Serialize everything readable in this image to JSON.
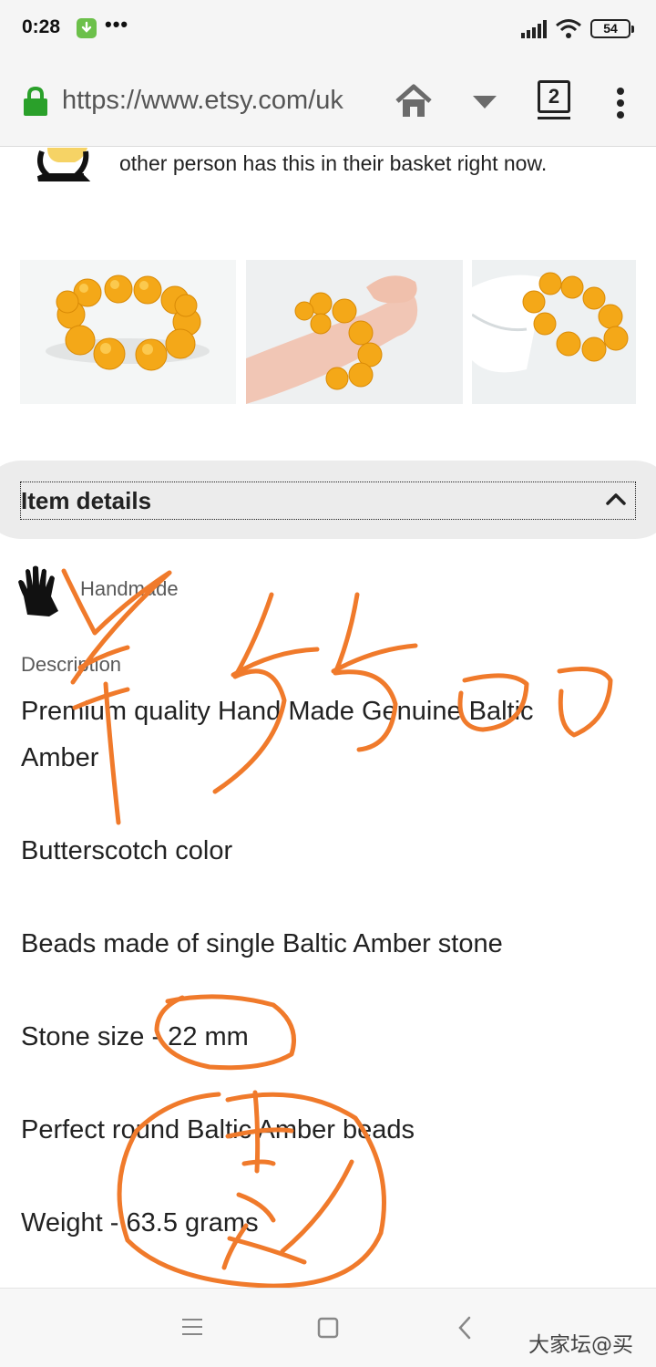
{
  "status_bar": {
    "time": "0:28",
    "dots": "•••",
    "battery": "54"
  },
  "browser": {
    "url": "https://www.etsy.com/uk",
    "tab_count": "2"
  },
  "listing": {
    "basket_notice": "other person has this in their basket right now.",
    "item_details_title": "Item details",
    "handmade_label": "Handmade",
    "description_label": "Description",
    "description_lines": [
      "Premium quality Hand Made Genuine Baltic",
      "Amber",
      "Butterscotch color",
      "Beads made of single Baltic Amber stone",
      "Stone size - 22 mm",
      "Perfect round Baltic Amber beads",
      "Weight - 63.5 grams"
    ]
  },
  "watermark": "大家坛@买",
  "colors": {
    "amber": "#f4a818",
    "annotation": "#f07a2b",
    "lock": "#2aa02a"
  },
  "icons": [
    "lock-icon",
    "home-icon",
    "dropdown-icon",
    "tabs-icon",
    "menu-icon",
    "chevron-up-icon",
    "hand-icon",
    "nav-menu-icon",
    "nav-home-icon",
    "nav-back-icon"
  ]
}
